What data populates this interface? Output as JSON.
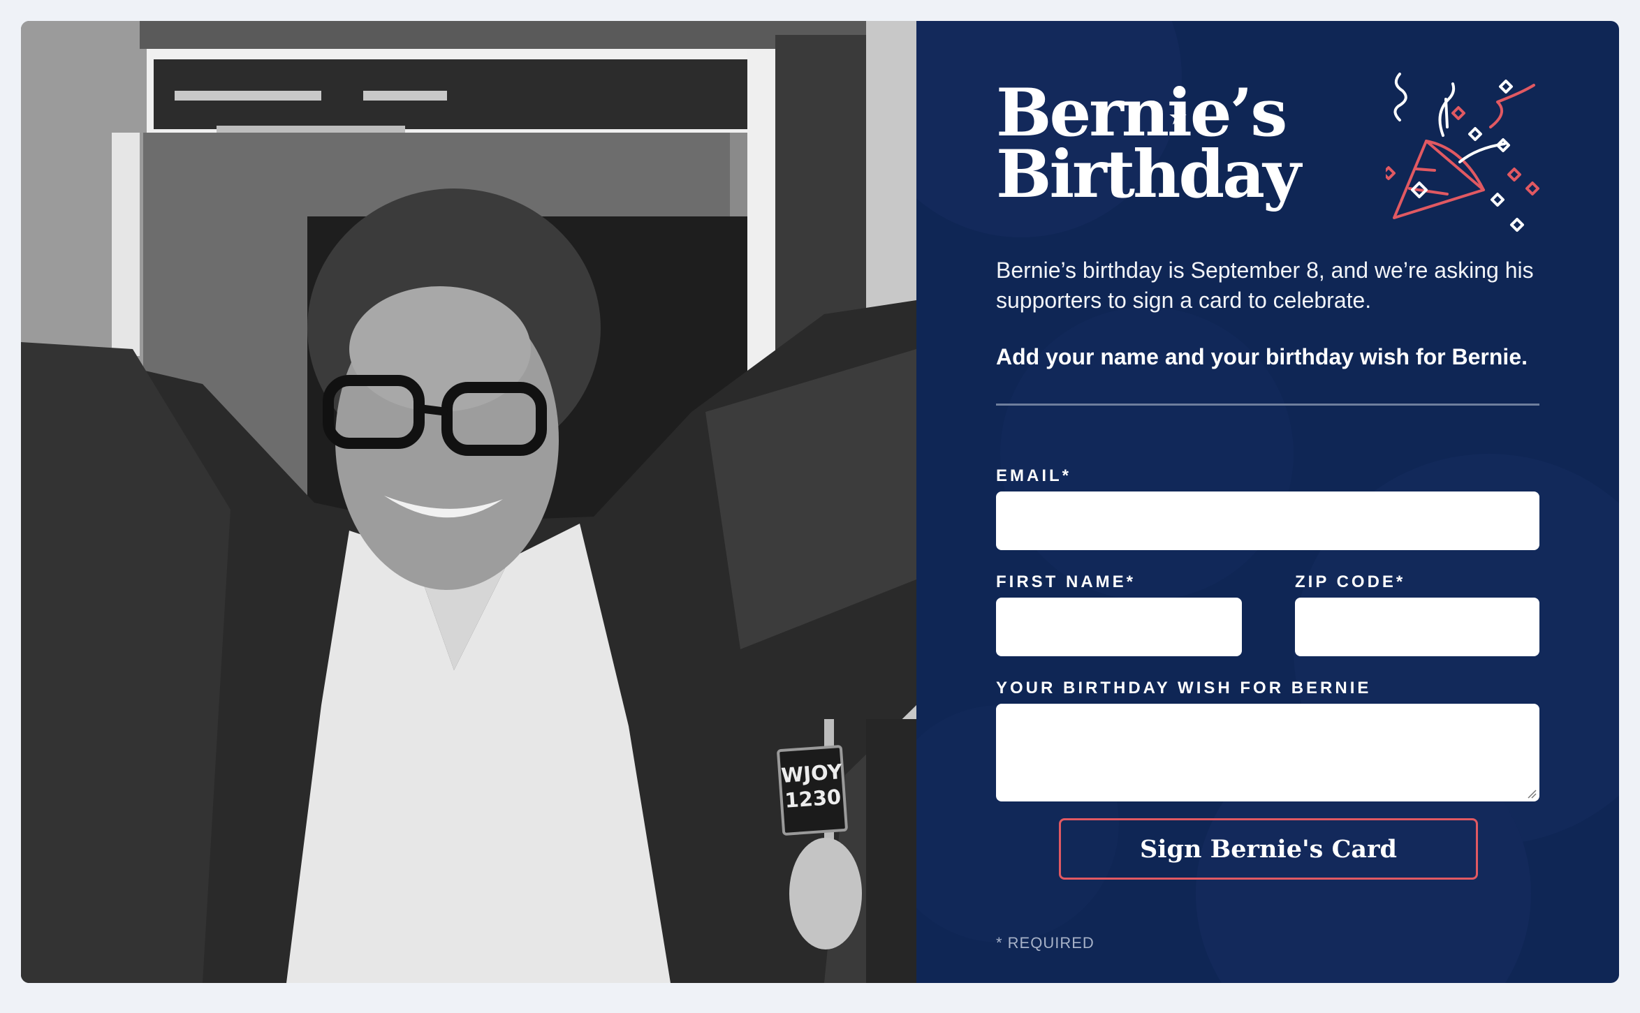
{
  "logo": {
    "line1": "Bernie’s",
    "line2": "Birthday"
  },
  "intro": {
    "text": "Bernie’s birthday is September 8, and we’re asking his supporters to sign a card to celebrate.",
    "strong": "Add your name and your birthday wish for Bernie."
  },
  "form": {
    "email_label": "EMAIL*",
    "first_name_label": "FIRST NAME*",
    "zip_label": "ZIP CODE*",
    "wish_label": "YOUR BIRTHDAY WISH FOR BERNIE",
    "email_value": "",
    "first_name_value": "",
    "zip_value": "",
    "wish_value": "",
    "submit_label": "Sign Bernie's Card",
    "required_note": "* REQUIRED"
  },
  "photo": {
    "sign_line1": "WJOY",
    "sign_line2": "1230"
  },
  "colors": {
    "page_bg": "#eff2f7",
    "panel_bg": "#0f2655",
    "accent_red": "#e15962",
    "text_white": "#ffffff",
    "muted_text": "#a7b2c8"
  },
  "icons": {
    "confetti": "party-popper-icon",
    "star": "star-icon"
  }
}
